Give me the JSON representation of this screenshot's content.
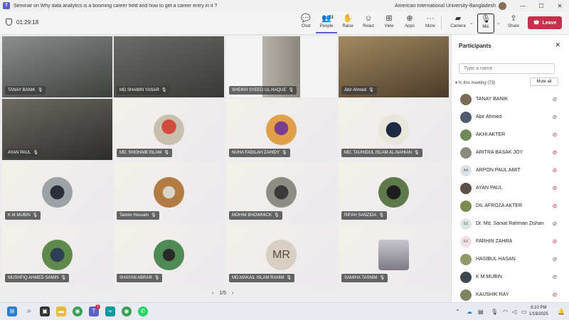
{
  "window": {
    "title": "Seminar on Why data analytics is a booming career field and how to get a career entry in it ?",
    "org": "American International University-Bangladesh",
    "minimize": "—",
    "maximize": "☐",
    "close": "✕"
  },
  "toolbar": {
    "timer": "01:29:18",
    "chat": "Chat",
    "people": "People",
    "people_count": "73",
    "raise": "Raise",
    "react": "React",
    "view": "View",
    "apps": "Apps",
    "more": "More",
    "camera": "Camera",
    "mic": "Mic",
    "share": "Share",
    "leave": "Leave",
    "icons": {
      "chat": "chat-icon",
      "people": "people-icon",
      "raise": "raise-hand-icon",
      "react": "smiley-icon",
      "view": "grid-icon",
      "apps": "apps-icon",
      "more": "more-icon",
      "camera": "camera-icon",
      "mic": "mic-off-icon",
      "share": "share-icon",
      "leave": "phone-icon"
    }
  },
  "tiles": [
    {
      "name": "TANAY BANIK",
      "kind": "video"
    },
    {
      "name": "MD SHAMIN YASAR",
      "kind": "video"
    },
    {
      "name": "SHEIKH SYEED UL HAQUE",
      "kind": "video"
    },
    {
      "name": "Abir Ahmed",
      "kind": "video"
    },
    {
      "name": "AYAN PAUL",
      "kind": "video"
    },
    {
      "name": "MD. SHOHAIB ISLAM",
      "kind": "photo"
    },
    {
      "name": "NUHA FADILAH ZAHIDY",
      "kind": "photo"
    },
    {
      "name": "MD. TAUHIDUL ISLAM AL-NAHIAN",
      "kind": "photo"
    },
    {
      "name": "K M MUBIN",
      "kind": "photo"
    },
    {
      "name": "Tamim Hossain",
      "kind": "photo"
    },
    {
      "name": "MOHIM BHOWMICK",
      "kind": "photo"
    },
    {
      "name": "RIFAH SANZIDA",
      "kind": "photo"
    },
    {
      "name": "MUSHFIQ AHMED SAMIN",
      "kind": "photo"
    },
    {
      "name": "SHAYAN ABRAR",
      "kind": "photo"
    },
    {
      "name": "MD.MAKAIL ISLAM RAHIM",
      "kind": "initials",
      "initials": "MR"
    },
    {
      "name": "SAMIHA TASNIM",
      "kind": "photo"
    }
  ],
  "pager": {
    "text": "1/5",
    "prev": "‹",
    "next": "›"
  },
  "panel": {
    "title": "Participants",
    "search_placeholder": "Type a name",
    "in_meeting": "In this meeting (73)",
    "mute_all": "Mute all",
    "participants": [
      {
        "name": "TANAY BANIK",
        "mic": "off-grey",
        "avatar": "photo"
      },
      {
        "name": "Abir Ahmed",
        "mic": "off-grey",
        "avatar": "photo"
      },
      {
        "name": "AKHI AKTER",
        "mic": "off-red",
        "avatar": "photo"
      },
      {
        "name": "ARITRA BASAK JOY",
        "mic": "off-red",
        "avatar": "photo"
      },
      {
        "name": "ARPON PAUL AMIT",
        "mic": "off-red",
        "avatar": "initials",
        "initials": "AA"
      },
      {
        "name": "AYAN PAUL",
        "mic": "off-red",
        "avatar": "photo"
      },
      {
        "name": "DIL AFROZA AKTER",
        "mic": "off-red",
        "avatar": "photo"
      },
      {
        "name": "Dr. Md. Saniat Rahman Zishan",
        "mic": "off-grey",
        "avatar": "initials",
        "initials": "DZ"
      },
      {
        "name": "FARHIN ZAHRA",
        "mic": "off-red",
        "avatar": "initials",
        "initials": "FZ"
      },
      {
        "name": "HASIBUL HASAN",
        "mic": "off-grey",
        "avatar": "photo"
      },
      {
        "name": "K M MUBIN",
        "mic": "off-grey",
        "avatar": "photo"
      },
      {
        "name": "KAUSHIK RAY",
        "mic": "off-red",
        "avatar": "photo"
      }
    ]
  },
  "taskbar": {
    "time": "8:10 PM",
    "date": "1/19/2025",
    "teams_badge": "1"
  },
  "colors": {
    "accent": "#5b5fc7",
    "leave": "#c4314b",
    "mic_off_red": "#c4314b",
    "mic_off_grey": "#616161"
  }
}
